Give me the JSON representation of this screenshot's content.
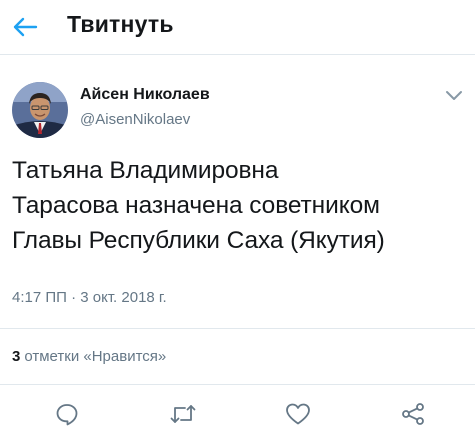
{
  "header": {
    "title": "Твитнуть",
    "back_icon": "arrow-left-icon",
    "accent": "#1da1f2"
  },
  "author": {
    "name": "Айсен Николаев",
    "handle": "@AisenNikolaev"
  },
  "tweet": {
    "lines": [
      "Татьяна Владимировна",
      "Тарасова назначена советником",
      "Главы Республики Саха (Якутия)"
    ],
    "timestamp": "4:17 ПП · 3 окт. 2018 г."
  },
  "stats": {
    "likes_count": "3",
    "likes_label": "отметки «Нравится»"
  },
  "actions": [
    "reply-icon",
    "retweet-icon",
    "like-icon",
    "share-icon"
  ],
  "colors": {
    "text": "#14171a",
    "secondary": "#657786",
    "border": "#e1e8ed"
  }
}
